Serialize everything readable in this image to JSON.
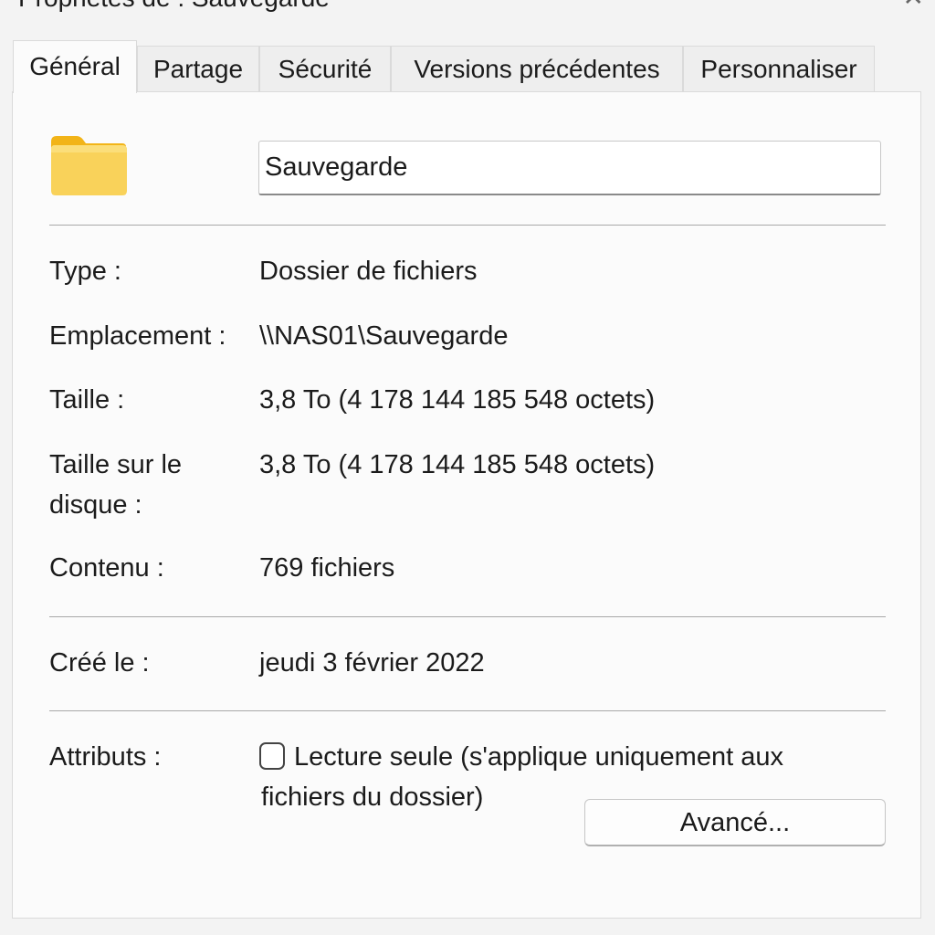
{
  "window": {
    "title": "Propriétés de : Sauvegarde",
    "close_glyph": "✕"
  },
  "tabs": [
    {
      "label": "Général",
      "active": true
    },
    {
      "label": "Partage",
      "active": false
    },
    {
      "label": "Sécurité",
      "active": false
    },
    {
      "label": "Versions précédentes",
      "active": false
    },
    {
      "label": "Personnaliser",
      "active": false
    }
  ],
  "general": {
    "folder_icon": "folder-icon",
    "folder_color": "#F5C242",
    "name_value": "Sauvegarde",
    "type_label": "Type :",
    "type_value": "Dossier de fichiers",
    "location_label": "Emplacement :",
    "location_value": "\\\\NAS01\\Sauvegarde",
    "size_label": "Taille :",
    "size_value": "3,8 To (4 178 144 185 548 octets)",
    "size_on_disk_label": "Taille sur le disque :",
    "size_on_disk_value": "3,8 To (4 178 144 185 548 octets)",
    "contents_label": "Contenu :",
    "contents_value": "769 fichiers",
    "created_label": "Créé le :",
    "created_value": "jeudi 3 février 2022",
    "attributes_label": "Attributs :",
    "readonly_checked": false,
    "readonly_label": "Lecture seule (s'applique uniquement aux fichiers du dossier)",
    "advanced_button": "Avancé..."
  }
}
